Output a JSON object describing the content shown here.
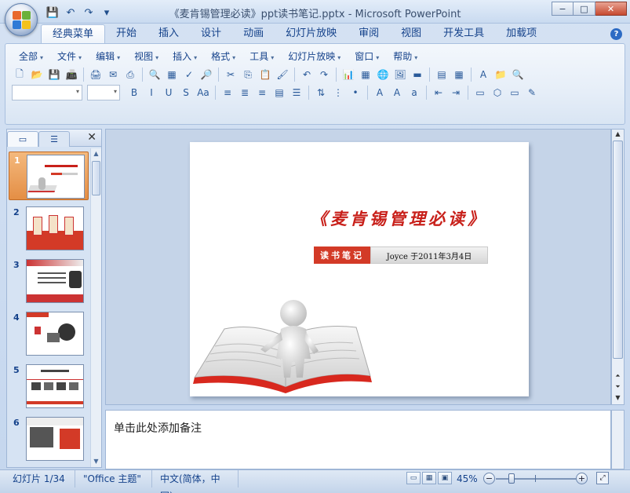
{
  "window": {
    "title": "《麦肯锡管理必读》ppt读书笔记.pptx - Microsoft PowerPoint",
    "controls": {
      "minimize": "−",
      "maximize": "□",
      "close": "✕"
    }
  },
  "quick_access": {
    "save": "💾",
    "undo": "↶",
    "redo": "↷",
    "customize": "▾"
  },
  "ribbon_tabs": [
    "经典菜单",
    "开始",
    "插入",
    "设计",
    "动画",
    "幻灯片放映",
    "审阅",
    "视图",
    "开发工具",
    "加载项"
  ],
  "active_tab": "经典菜单",
  "help": "?",
  "menus": [
    "全部",
    "文件",
    "编辑",
    "视图",
    "插入",
    "格式",
    "工具",
    "幻灯片放映",
    "窗口",
    "帮助"
  ],
  "toolbar1": [
    "🗋",
    "📂",
    "💾",
    "📠",
    "🖨",
    "✉",
    "⎙",
    "🔍",
    "▦",
    "✓",
    "🔎",
    "✂",
    "⎘",
    "📋",
    "🖌",
    "↶",
    "↷",
    "📊",
    "▦",
    "🌐",
    "🖼",
    "▬",
    "▤",
    "▦",
    "A",
    "📁",
    "🔍"
  ],
  "toolbar2": [
    "B",
    "I",
    "U",
    "S",
    "Aa",
    "≡",
    "≣",
    "≡",
    "▤",
    "☰",
    "⇅",
    "⋮",
    "•",
    "A",
    "A",
    "a",
    "⇤",
    "⇥",
    "▭",
    "⬡",
    "▭",
    "✎"
  ],
  "outline_tabs": {
    "slides_icon": "▭",
    "outline_icon": "☰",
    "close": "✕"
  },
  "slides": [
    {
      "num": "1",
      "selected": true
    },
    {
      "num": "2"
    },
    {
      "num": "3"
    },
    {
      "num": "4"
    },
    {
      "num": "5"
    },
    {
      "num": "6"
    }
  ],
  "slide": {
    "title": "《麦肯锡管理必读》",
    "badge_label": "读书笔记",
    "badge_text": "Joyce 于2011年3月4日"
  },
  "notes": {
    "placeholder": "单击此处添加备注"
  },
  "status": {
    "slide_pos": "幻灯片 1/34",
    "theme": "\"Office 主题\"",
    "language": "中文(简体，中国)",
    "zoom": "45%",
    "zoom_fraction": 0.45
  },
  "colors": {
    "accent_red": "#d33a27",
    "title_red": "#c8201a",
    "ribbon_blue": "#15428b",
    "selection_orange": "#e48e45"
  }
}
